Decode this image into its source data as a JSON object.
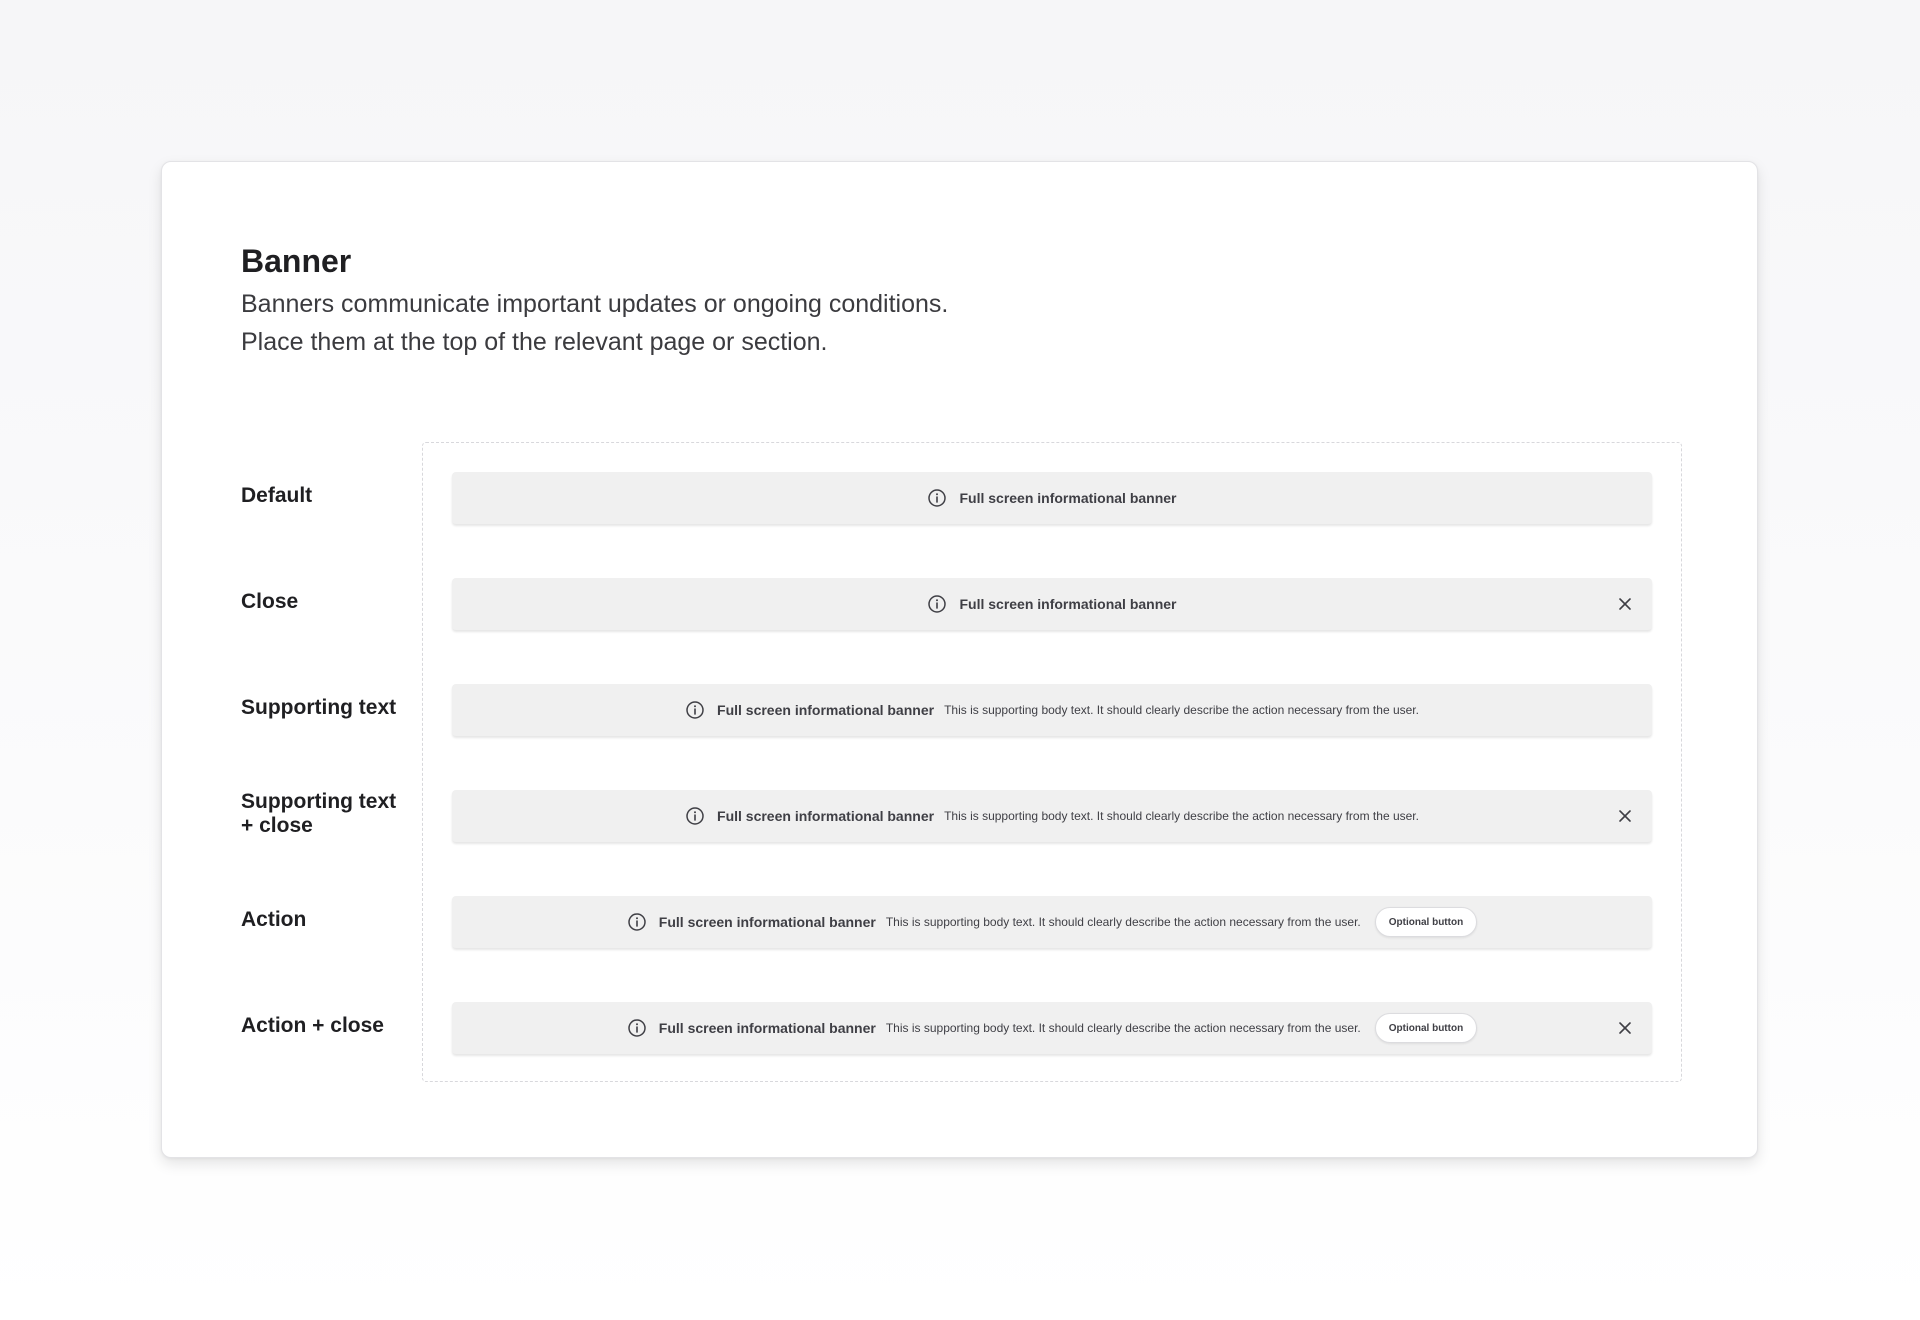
{
  "header": {
    "title": "Banner",
    "description_line1": "Banners communicate important updates or ongoing conditions.",
    "description_line2": "Place them at the top of the relevant page or section."
  },
  "rows": [
    {
      "label": "Default",
      "banner": {
        "title": "Full screen informational banner"
      }
    },
    {
      "label": "Close",
      "banner": {
        "title": "Full screen informational banner"
      }
    },
    {
      "label": "Supporting text",
      "banner": {
        "title": "Full screen informational banner",
        "body": "This is supporting body text. It should clearly describe the action necessary from the user."
      }
    },
    {
      "label_line1": "Supporting text",
      "label_line2": "+ close",
      "banner": {
        "title": "Full screen informational banner",
        "body": "This is supporting body text. It should clearly describe the action necessary from the user."
      }
    },
    {
      "label": "Action",
      "banner": {
        "title": "Full screen informational banner",
        "body": "This is supporting body text. It should clearly describe the action necessary from the user.",
        "button": "Optional button"
      }
    },
    {
      "label": "Action + close",
      "banner": {
        "title": "Full screen informational banner",
        "body": "This is supporting body text. It should clearly describe the action necessary from the user.",
        "button": "Optional button"
      }
    }
  ],
  "icons": {
    "info": "info-circle-icon",
    "close": "close-x-icon"
  },
  "colors": {
    "banner_background": "#f0f0f0",
    "text": "#3f3f45",
    "heading": "#1f1f22"
  }
}
